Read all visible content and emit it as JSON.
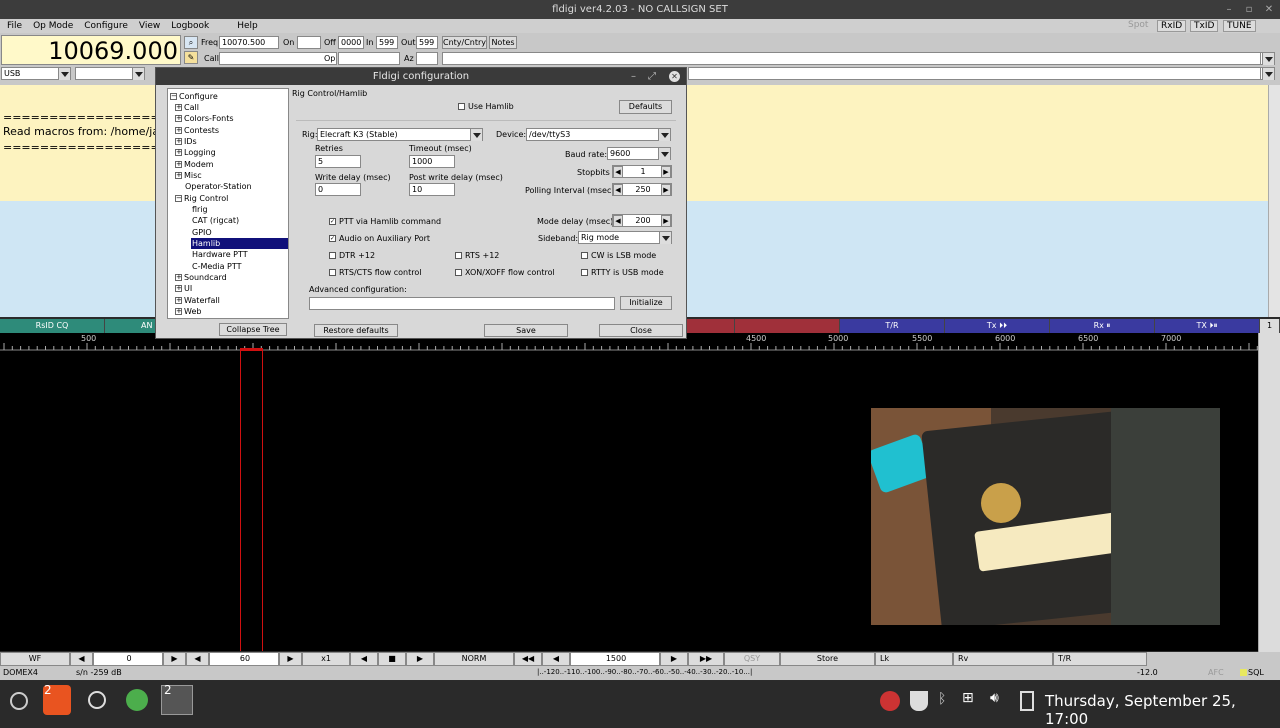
{
  "window": {
    "title": "fldigi ver4.2.03 - NO CALLSIGN SET"
  },
  "menu": [
    "File",
    "Op Mode",
    "Configure",
    "View",
    "Logbook",
    "Help"
  ],
  "right_buttons": {
    "spot": "Spot",
    "rxid": "RxID",
    "txid": "TxID",
    "tune": "TUNE"
  },
  "freq": {
    "display": "10069.000",
    "freq_label": "Freq",
    "freq_value": "10070.500",
    "on_label": "On",
    "off_label": "Off",
    "off_value": "0000",
    "in_label": "In",
    "in_value": "599",
    "out_label": "Out",
    "out_value": "599",
    "cnty_label": "Cnty/Cntry",
    "notes_label": "Notes",
    "call_label": "Call",
    "op_label": "Op",
    "az_label": "Az",
    "mode": "USB"
  },
  "rx_text": {
    "line1": "==========================",
    "line2": "Read macros from: /home/jac",
    "line3": "=========================="
  },
  "macros": [
    "RsID CQ",
    "AN",
    "",
    "",
    "",
    "",
    "",
    "",
    "T/R",
    "Tx ⏵⏵",
    "Rx ⏸",
    "TX ⏵⏸",
    "1"
  ],
  "scale": [
    "500",
    "4500",
    "5000",
    "5500",
    "6000",
    "6500",
    "7000"
  ],
  "bottom": {
    "wf": "WF",
    "val1": "0",
    "val2": "60",
    "x1": "x1",
    "norm": "NORM",
    "freq": "1500",
    "qsy": "QSY",
    "store": "Store",
    "lk": "Lk",
    "rv": "Rv",
    "tr": "T/R"
  },
  "status": {
    "mode": "DOMEX4",
    "sn": "s/n -259 dB",
    "scale": "|..-120..-110..-100..-90..-80..-70..-60..-50..-40..-30..-20..-10...|",
    "level": "-12.0",
    "afc": "AFC",
    "sql": "SQL"
  },
  "taskbar": {
    "clock": "Thursday, September 25, 17:00",
    "badge1": "2",
    "badge2": "2"
  },
  "dialog": {
    "title": "Fldigi configuration",
    "tree": {
      "root": "Configure",
      "items": [
        "Call",
        "Colors-Fonts",
        "Contests",
        "IDs",
        "Logging",
        "Modem",
        "Misc",
        "Operator-Station",
        "Rig Control",
        "flrig",
        "CAT (rigcat)",
        "GPIO",
        "Hamlib",
        "Hardware PTT",
        "C-Media PTT",
        "Soundcard",
        "UI",
        "Waterfall",
        "Web"
      ]
    },
    "panel": {
      "heading": "Rig Control/Hamlib",
      "use_hamlib": "Use Hamlib",
      "defaults": "Defaults",
      "rig_label": "Rig:",
      "rig_value": "Elecraft K3  (Stable)",
      "device_label": "Device:",
      "device_value": "/dev/ttyS3",
      "retries_label": "Retries",
      "retries_value": "5",
      "timeout_label": "Timeout (msec)",
      "timeout_value": "1000",
      "baud_label": "Baud rate:",
      "baud_value": "9600",
      "stopbits_label": "Stopbits",
      "stopbits_value": "1",
      "write_delay_label": "Write delay (msec)",
      "write_delay_value": "0",
      "post_write_label": "Post write delay (msec)",
      "post_write_value": "10",
      "polling_label": "Polling Interval (msec)",
      "polling_value": "250",
      "ptt_hamlib": "PTT via Hamlib command",
      "mode_delay_label": "Mode delay (msec)",
      "mode_delay_value": "200",
      "audio_aux": "Audio on Auxiliary Port",
      "sideband_label": "Sideband:",
      "sideband_value": "Rig mode",
      "dtr": "DTR +12",
      "rts": "RTS +12",
      "cw_lsb": "CW is LSB mode",
      "rts_cts": "RTS/CTS flow control",
      "xon": "XON/XOFF flow control",
      "rtty_usb": "RTTY is USB mode",
      "advanced_label": "Advanced configuration:",
      "advanced_value": "",
      "initialize": "Initialize"
    },
    "buttons": {
      "collapse": "Collapse Tree",
      "restore": "Restore defaults",
      "save": "Save",
      "close": "Close"
    }
  }
}
